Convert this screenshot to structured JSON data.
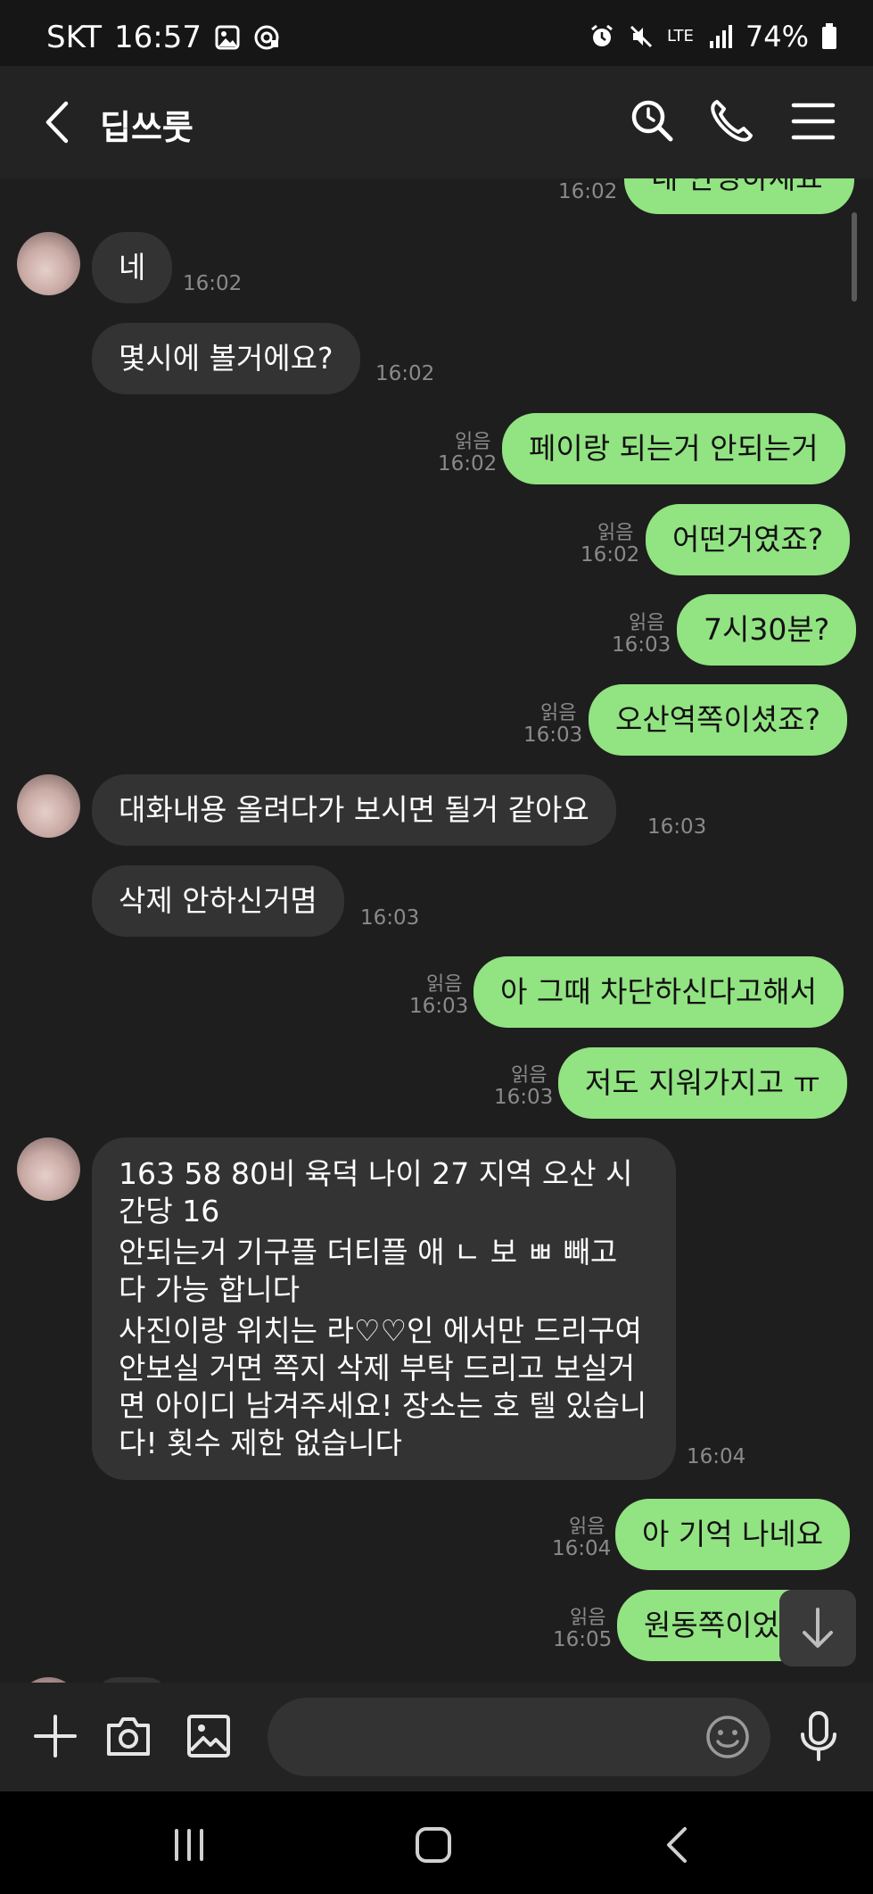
{
  "status_bar": {
    "carrier": "SKT",
    "time": "16:57",
    "network": "LTE",
    "battery": "74%"
  },
  "header": {
    "title": "딥쓰룻"
  },
  "messages": [
    {
      "side": "out",
      "text": "네 안녕하세요",
      "time": "16:02"
    },
    {
      "side": "in",
      "text": "네",
      "time": "16:02"
    },
    {
      "side": "in",
      "text": "몇시에 볼거에요?",
      "time": "16:02"
    },
    {
      "side": "out",
      "text": "페이랑 되는거 안되는거",
      "time": "16:02",
      "read": "읽음"
    },
    {
      "side": "out",
      "text": "어떤거였죠?",
      "time": "16:02",
      "read": "읽음"
    },
    {
      "side": "out",
      "text": "7시30분?",
      "time": "16:03",
      "read": "읽음"
    },
    {
      "side": "out",
      "text": "오산역쪽이셨죠?",
      "time": "16:03",
      "read": "읽음"
    },
    {
      "side": "in",
      "text": "대화내용 올려다가 보시면 될거 같아요",
      "time": "16:03"
    },
    {
      "side": "in",
      "text": "삭제 안하신거몀",
      "time": "16:03"
    },
    {
      "side": "out",
      "text": "아 그때 차단하신다고해서",
      "time": "16:03",
      "read": "읽음"
    },
    {
      "side": "out",
      "text": "저도 지워가지고 ㅠ",
      "time": "16:03",
      "read": "읽음"
    },
    {
      "side": "in",
      "paragraphs": [
        "163 58 80비 육덕 나이 27 지역 오산 시간당 16",
        "안되는거 기구플 더티플 애 ㄴ 보 ㅃ 빼고 다 가능 합니다",
        "사진이랑 위치는 라♡♡인 에서만 드리구여 안보실 거면 쪽지 삭제 부탁 드리고 보실거면 아이디 남겨주세요! 장소는 호   텔 있습니다!  횟수 제한 없습니다"
      ],
      "time": "16:04"
    },
    {
      "side": "out",
      "text": "아 기억 나네요",
      "time": "16:04",
      "read": "읽음"
    },
    {
      "side": "out",
      "text": "원동쪽이었",
      "time": "16:05",
      "read": "읽음"
    }
  ],
  "input": {
    "placeholder": ""
  },
  "colors": {
    "bubble_out": "#92e382",
    "bubble_in": "#333333",
    "background": "#1e1e1e"
  }
}
